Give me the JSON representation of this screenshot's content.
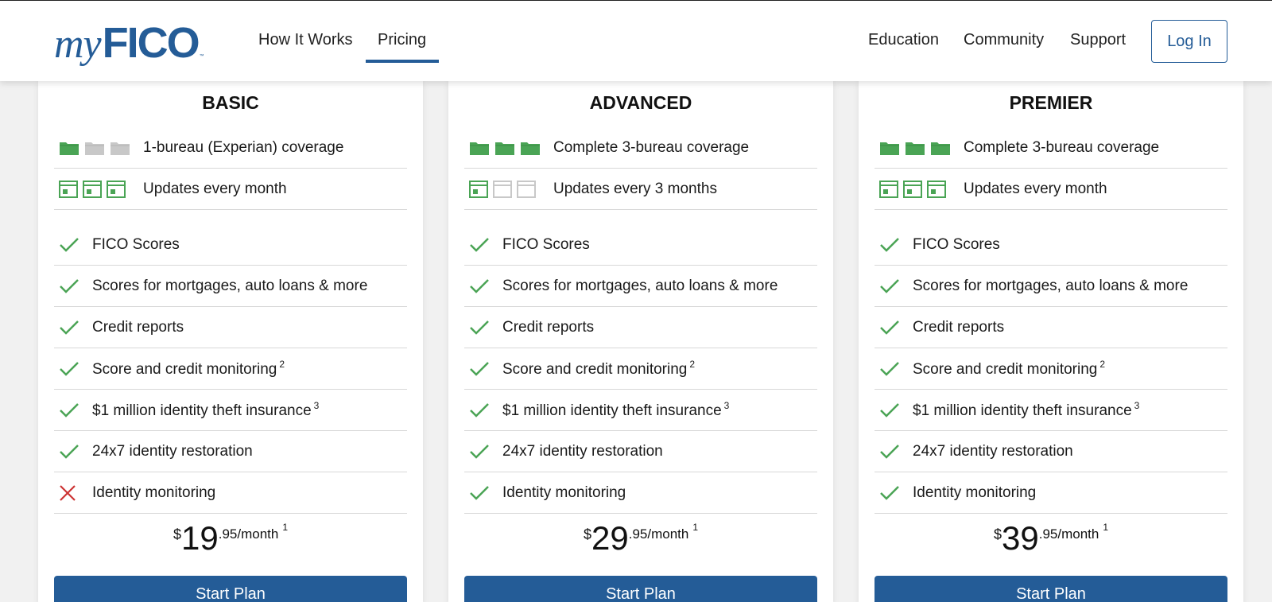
{
  "brand": {
    "logo_my": "my",
    "logo_fico": "FICO",
    "logo_tm": "™"
  },
  "nav": {
    "how_it_works": "How It Works",
    "pricing": "Pricing",
    "education": "Education",
    "community": "Community",
    "support": "Support",
    "login": "Log In",
    "active_tab": "Pricing"
  },
  "colors": {
    "brand_blue": "#245c97",
    "check_green": "#4aa455",
    "x_red": "#cc3333",
    "inactive_gray": "#c8c8c8"
  },
  "plans": [
    {
      "name": "BASIC",
      "coverage": {
        "text": "1-bureau (Experian) coverage",
        "active_bureaus": 1,
        "icon": "folder-icon"
      },
      "updates": {
        "text": "Updates every month",
        "active_calendars": 3,
        "icon": "calendar-icon"
      },
      "features": [
        {
          "label": "FICO Scores",
          "sup": "",
          "included": true
        },
        {
          "label": "Scores for mortgages, auto loans & more",
          "sup": "",
          "included": true
        },
        {
          "label": "Credit reports",
          "sup": "",
          "included": true
        },
        {
          "label": "Score and credit monitoring",
          "sup": "2",
          "included": true
        },
        {
          "label": "$1 million identity theft insurance",
          "sup": "3",
          "included": true
        },
        {
          "label": "24x7 identity restoration",
          "sup": "",
          "included": true
        },
        {
          "label": "Identity monitoring",
          "sup": "",
          "included": false
        }
      ],
      "price": {
        "currency": "$",
        "dollars": "19",
        "cents_period": ".95/month",
        "footnote": "1"
      },
      "cta": "Start Plan"
    },
    {
      "name": "ADVANCED",
      "coverage": {
        "text": "Complete 3-bureau coverage",
        "active_bureaus": 3,
        "icon": "folder-icon"
      },
      "updates": {
        "text": "Updates every 3 months",
        "active_calendars": 1,
        "icon": "calendar-icon"
      },
      "features": [
        {
          "label": "FICO Scores",
          "sup": "",
          "included": true
        },
        {
          "label": "Scores for mortgages, auto loans & more",
          "sup": "",
          "included": true
        },
        {
          "label": "Credit reports",
          "sup": "",
          "included": true
        },
        {
          "label": "Score and credit monitoring",
          "sup": "2",
          "included": true
        },
        {
          "label": "$1 million identity theft insurance",
          "sup": "3",
          "included": true
        },
        {
          "label": "24x7 identity restoration",
          "sup": "",
          "included": true
        },
        {
          "label": "Identity monitoring",
          "sup": "",
          "included": true
        }
      ],
      "price": {
        "currency": "$",
        "dollars": "29",
        "cents_period": ".95/month",
        "footnote": "1"
      },
      "cta": "Start Plan"
    },
    {
      "name": "PREMIER",
      "coverage": {
        "text": "Complete 3-bureau coverage",
        "active_bureaus": 3,
        "icon": "folder-icon"
      },
      "updates": {
        "text": "Updates every month",
        "active_calendars": 3,
        "icon": "calendar-icon"
      },
      "features": [
        {
          "label": "FICO Scores",
          "sup": "",
          "included": true
        },
        {
          "label": "Scores for mortgages, auto loans & more",
          "sup": "",
          "included": true
        },
        {
          "label": "Credit reports",
          "sup": "",
          "included": true
        },
        {
          "label": "Score and credit monitoring",
          "sup": "2",
          "included": true
        },
        {
          "label": "$1 million identity theft insurance",
          "sup": "3",
          "included": true
        },
        {
          "label": "24x7 identity restoration",
          "sup": "",
          "included": true
        },
        {
          "label": "Identity monitoring",
          "sup": "",
          "included": true
        }
      ],
      "price": {
        "currency": "$",
        "dollars": "39",
        "cents_period": ".95/month",
        "footnote": "1"
      },
      "cta": "Start Plan"
    }
  ]
}
